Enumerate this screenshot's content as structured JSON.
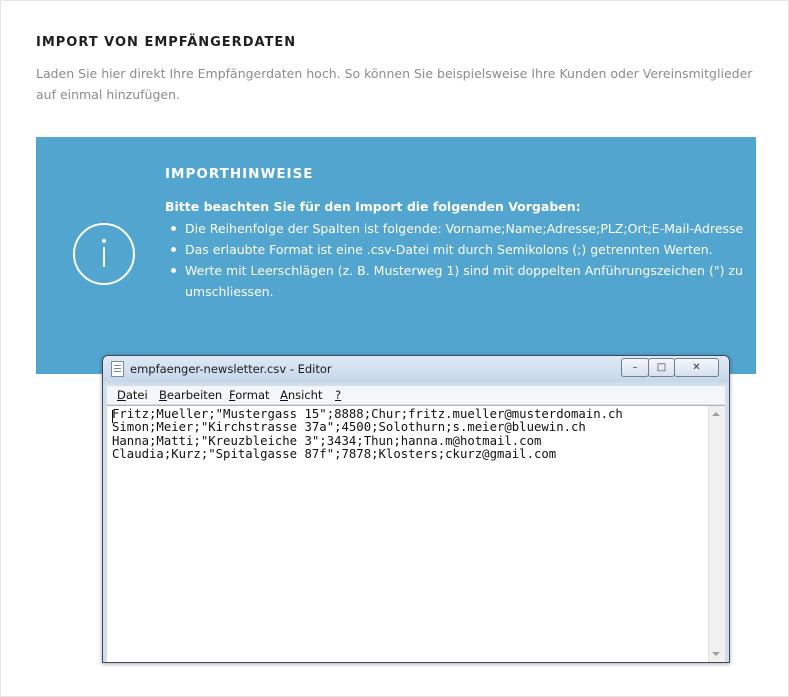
{
  "page": {
    "heading": "IMPORT VON EMPFÄNGERDATEN",
    "intro": "Laden Sie hier direkt Ihre Empfängerdaten hoch. So können Sie beispielsweise Ihre Kunden oder Vereinsmitglieder auf einmal hinzufügen."
  },
  "info_box": {
    "icon": "info-circle-icon",
    "title": "IMPORTHINWEISE",
    "lead": "Bitte beachten Sie für den Import die folgenden Vorgaben:",
    "items": [
      "Die Reihenfolge der Spalten ist folgende: Vorname;Name;Adresse;PLZ;Ort;E-Mail-Adresse",
      "Das erlaubte Format ist eine .csv-Datei mit durch Semikolons (;) getrennten Werten.",
      "Werte mit Leerschlägen (z. B. Musterweg 1) sind mit doppelten Anführungszeichen (\") zu umschliessen."
    ],
    "colors": {
      "background": "#52a5cf",
      "text": "#ffffff"
    }
  },
  "notepad": {
    "title": "empfaenger-newsletter.csv - Editor",
    "menu": [
      "Datei",
      "Bearbeiten",
      "Format",
      "Ansicht",
      "?"
    ],
    "lines": [
      "Fritz;Mueller;\"Mustergass 15\";8888;Chur;fritz.mueller@musterdomain.ch",
      "Simon;Meier;\"Kirchstrasse 37a\";4500;Solothurn;s.meier@bluewin.ch",
      "Hanna;Matti;\"Kreuzbleiche 3\";3434;Thun;hanna.m@hotmail.com",
      "Claudia;Kurz;\"Spitalgasse 87f\";7878;Klosters;ckurz@gmail.com"
    ]
  }
}
